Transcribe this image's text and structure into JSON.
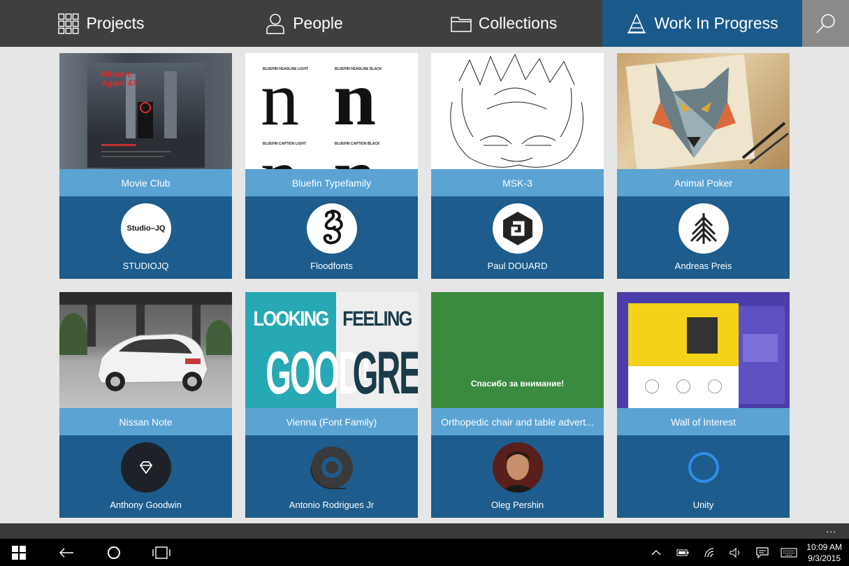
{
  "nav": {
    "tabs": [
      {
        "label": "Projects",
        "icon": "grid-icon"
      },
      {
        "label": "People",
        "icon": "person-icon"
      },
      {
        "label": "Collections",
        "icon": "folder-icon"
      },
      {
        "label": "Work In Progress",
        "icon": "wip-icon",
        "active": true
      }
    ],
    "search_icon": "search-icon"
  },
  "cards": [
    {
      "title": "Movie Club",
      "owner": "STUDIOJQ",
      "avatar_text": "Studio–JQ",
      "thumb_text": "Hitman: Agent 47"
    },
    {
      "title": "Bluefin Typefamily",
      "owner": "Floodfonts",
      "thumb_labels": [
        "BLUEFIN HEADLINE LIGHT",
        "BLUEFIN HEADLINE BLACK",
        "BLUEFIN CAPTION LIGHT",
        "BLUEFIN CAPTION BLACK"
      ]
    },
    {
      "title": "MSK-3",
      "owner": "Paul DOUARD"
    },
    {
      "title": "Animal Poker",
      "owner": "Andreas Preis"
    },
    {
      "title": "Nissan Note",
      "owner": "Anthony Goodwin"
    },
    {
      "title": "Vienna (Font Family)",
      "owner": "Antonio Rodrigues Jr",
      "thumb_words": [
        "LOOKING",
        "FEELING",
        "GOOD!",
        "GREAT!"
      ]
    },
    {
      "title": "Orthopedic chair and table advert...",
      "owner": "Oleg Pershin",
      "thumb_text": "Спасибо за внимание!"
    },
    {
      "title": "Wall of Interest",
      "owner": "Unity"
    }
  ],
  "colors": {
    "nav_bg": "#3f3f3f",
    "active_tab": "#1a5a8a",
    "title_bar": "#5ba3d3",
    "card_bg": "#1d5c8c"
  },
  "appbar": {
    "more": "..."
  },
  "taskbar": {
    "time": "10:09 AM",
    "date": "9/3/2015"
  }
}
